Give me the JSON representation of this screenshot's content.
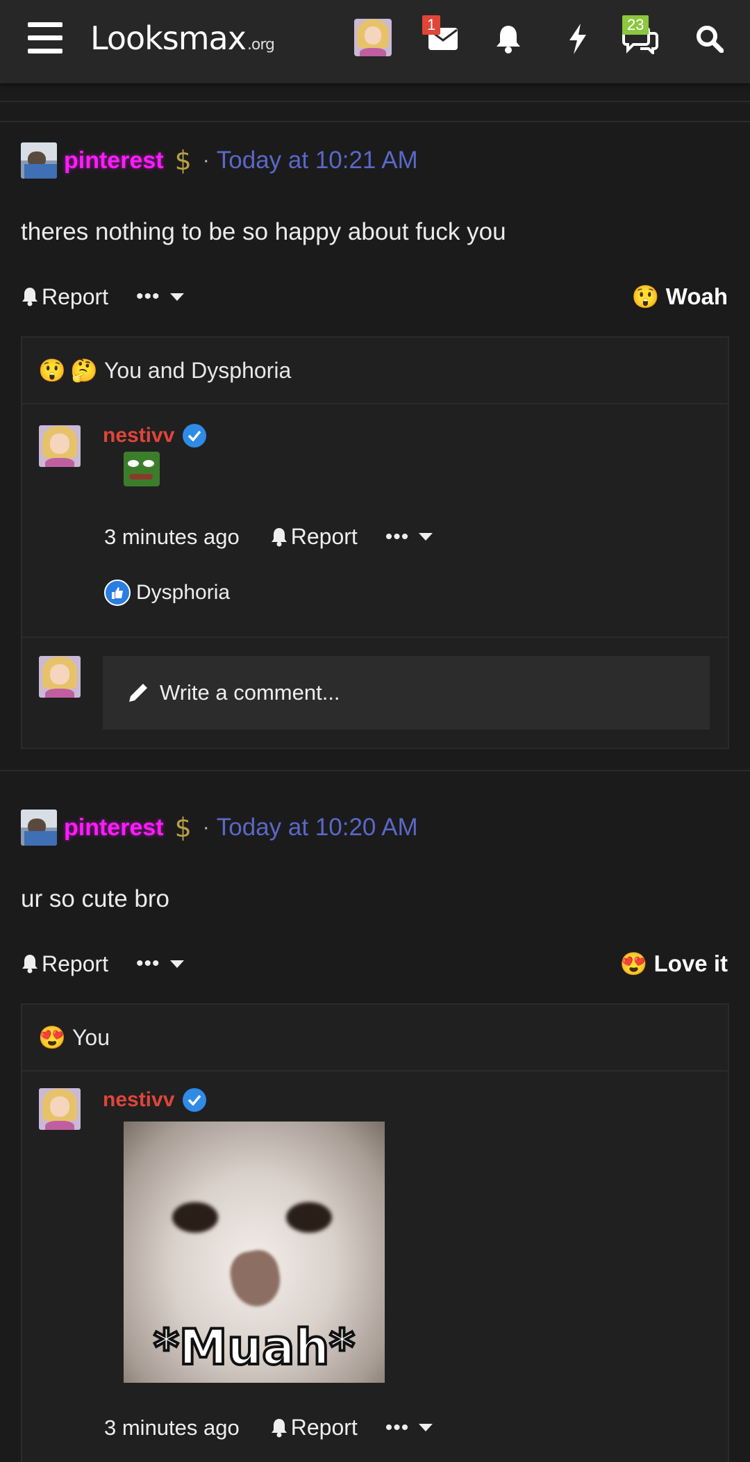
{
  "topbar": {
    "logo_text": "Looksmax",
    "logo_suffix": ".org",
    "messages_badge": "1",
    "conversations_badge": "23"
  },
  "posts": [
    {
      "author": "pinterest",
      "dollar": "$",
      "separator": "·",
      "time": "Today at 10:21 AM",
      "text": "theres nothing to be so happy about fuck you",
      "report_label": "Report",
      "more_label": "•••",
      "reaction_label": "Woah",
      "reaction_emoji": "😲",
      "reactors_text": "You and Dysphoria",
      "comment": {
        "author": "nestivv",
        "time_ago": "3 minutes ago",
        "report_label": "Report",
        "more_label": "•••",
        "liker": "Dysphoria"
      },
      "write_comment_placeholder": "Write a comment..."
    },
    {
      "author": "pinterest",
      "dollar": "$",
      "separator": "·",
      "time": "Today at 10:20 AM",
      "text": "ur so cute bro",
      "report_label": "Report",
      "more_label": "•••",
      "reaction_label": "Love it",
      "reaction_emoji": "😍",
      "reactors_text": "You",
      "comment": {
        "author": "nestivv",
        "gif_caption": "*Muah*",
        "time_ago": "3 minutes ago",
        "report_label": "Report",
        "more_label": "•••"
      }
    }
  ],
  "colors": {
    "background": "#1b1b1b",
    "topbar": "#272727",
    "username_pink": "#ff1aff",
    "timestamp": "#5a68c8",
    "comment_author": "#e0453a",
    "badge_red": "#e0453a",
    "badge_green": "#8dc63f",
    "verified_blue": "#2f8be6"
  }
}
